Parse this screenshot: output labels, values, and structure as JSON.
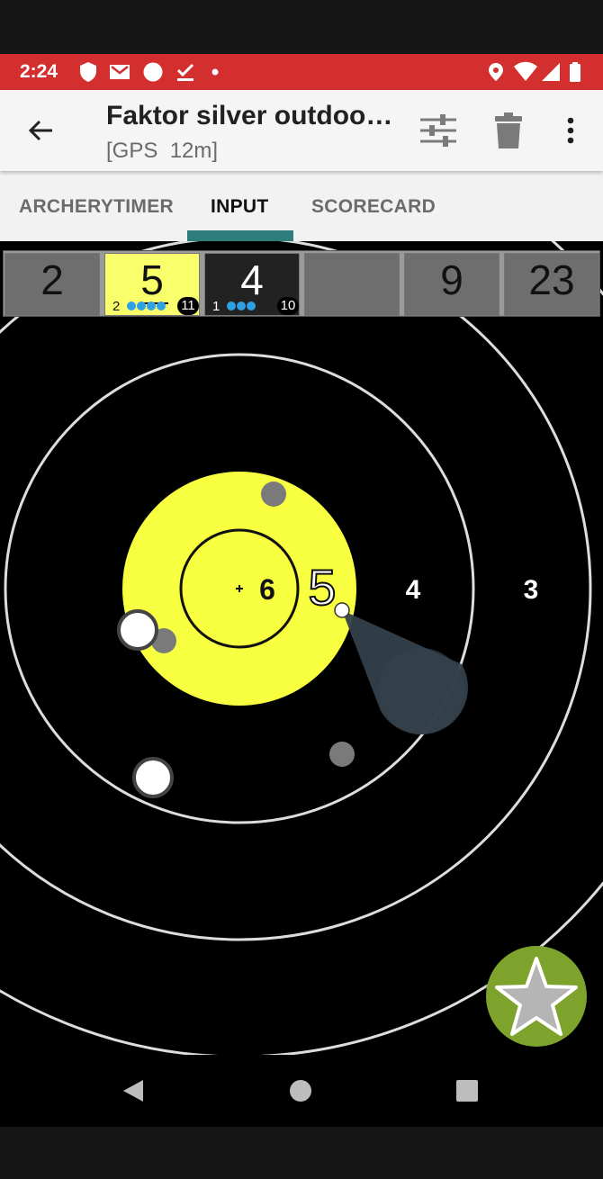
{
  "status_bar": {
    "time": "2:24",
    "background_color": "#d32f2f",
    "left_icons": [
      "shield-icon",
      "gmail-icon",
      "circle-icon",
      "check-icon",
      "dot-icon"
    ],
    "right_icons": [
      "location-icon",
      "wifi-icon",
      "signal-icon",
      "battery-icon"
    ]
  },
  "app_bar": {
    "title": "Faktor silver outdoo…",
    "subtitle": "[GPS  12m]",
    "icons": [
      "back-arrow-icon",
      "sliders-icon",
      "trash-icon",
      "more-vert-icon"
    ]
  },
  "tabs": [
    {
      "label": "ARCHERYTIMER",
      "active": false
    },
    {
      "label": "INPUT",
      "active": true
    },
    {
      "label": "SCORECARD",
      "active": false
    }
  ],
  "accent_color": "#2e7d7d",
  "score_cells": [
    {
      "value": "2",
      "style": "gray",
      "count": "",
      "dots": 0,
      "badge": ""
    },
    {
      "value": "5",
      "style": "yellow",
      "count": "2",
      "dots": 4,
      "badge": "11"
    },
    {
      "value": "4",
      "style": "dark",
      "count": "1",
      "dots": 3,
      "badge": "10"
    },
    {
      "value": "",
      "style": "gray",
      "count": "",
      "dots": 0,
      "badge": ""
    },
    {
      "value": "9",
      "style": "gray",
      "count": "",
      "dots": 0,
      "badge": ""
    },
    {
      "value": "23",
      "style": "gray",
      "count": "",
      "dots": 0,
      "badge": ""
    }
  ],
  "target": {
    "ring_labels": {
      "inner": "6",
      "yellow": "5",
      "middle": "4",
      "outer": "3"
    },
    "magnifier_value": "5",
    "yellow_color": "#f8ff40",
    "ring_line_color": "#dddddd"
  },
  "fab": {
    "icon": "star-icon",
    "color": "#7ea32c"
  },
  "nav_bar": {
    "icons": [
      "back-triangle-icon",
      "home-circle-icon",
      "recents-square-icon"
    ]
  }
}
